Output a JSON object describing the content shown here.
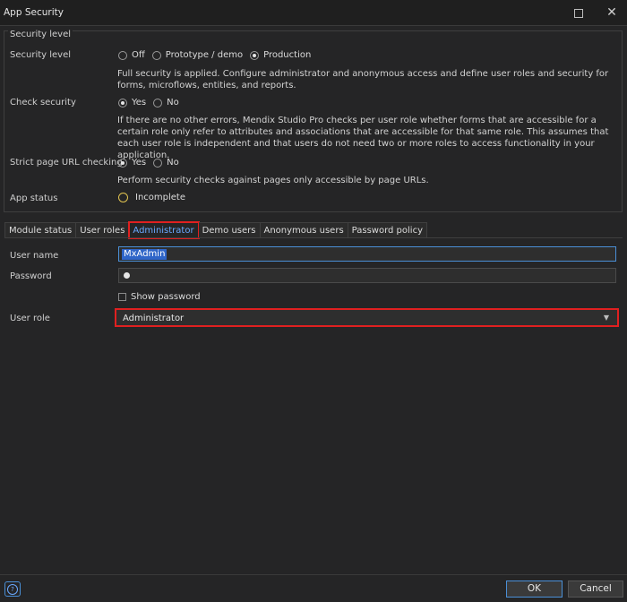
{
  "window": {
    "title": "App Security"
  },
  "security_group": {
    "legend": "Security level",
    "security_level": {
      "label": "Security level",
      "options": [
        "Off",
        "Prototype / demo",
        "Production"
      ],
      "selected": "Production",
      "description": "Full security is applied. Configure administrator and anonymous access and define user roles and security for forms, microflows, entities, and reports."
    },
    "check_security": {
      "label": "Check security",
      "options": [
        "Yes",
        "No"
      ],
      "selected": "Yes",
      "description": "If there are no other errors, Mendix Studio Pro checks per user role whether forms that are accessible for a certain role only refer to attributes and associations that are accessible for that same role. This assumes that each user role is independent and that users do not need two or more roles to access functionality in your application."
    },
    "strict_url": {
      "label": "Strict page URL checking",
      "options": [
        "Yes",
        "No"
      ],
      "selected": "Yes",
      "description": "Perform security checks against pages only accessible by page URLs."
    },
    "app_status": {
      "label": "App status",
      "value": "Incomplete",
      "status_color": "#e0c350"
    }
  },
  "tabs": [
    "Module status",
    "User roles",
    "Administrator",
    "Demo users",
    "Anonymous users",
    "Password policy"
  ],
  "active_tab": "Administrator",
  "admin": {
    "user_name_label": "User name",
    "user_name_value": "MxAdmin",
    "password_label": "Password",
    "show_password_label": "Show password",
    "user_role_label": "User role",
    "user_role_value": "Administrator"
  },
  "footer": {
    "help_icon": "question-icon",
    "ok_label": "OK",
    "cancel_label": "Cancel"
  },
  "colors": {
    "accent": "#4a8fd6",
    "highlight": "#e02020",
    "background": "#252526"
  }
}
